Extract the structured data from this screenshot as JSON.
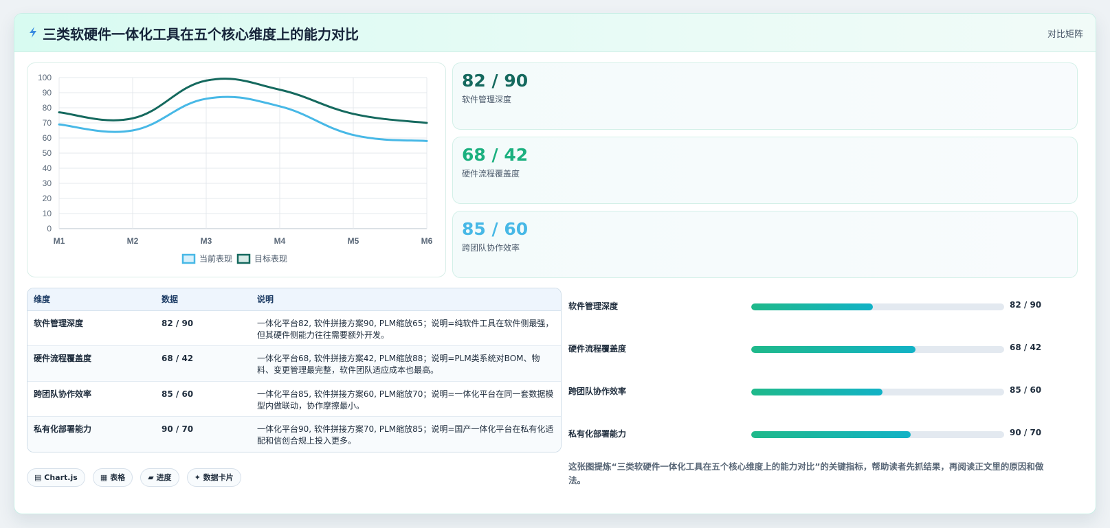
{
  "header": {
    "icon": "lightning-icon",
    "title": "三类软硬件一体化工具在五个核心维度上的能力对比",
    "tag": "对比矩阵"
  },
  "colors": {
    "current": "#47b8e6",
    "target": "#15695e",
    "kpi1": "#15695e",
    "kpi2": "#1bb07f",
    "kpi3": "#47b8e6"
  },
  "chart_data": {
    "type": "line",
    "x": [
      "M1",
      "M2",
      "M3",
      "M4",
      "M5",
      "M6"
    ],
    "ylim": [
      0,
      100
    ],
    "yticks": [
      "0",
      "10",
      "20",
      "30",
      "40",
      "50",
      "60",
      "70",
      "80",
      "90",
      "100"
    ],
    "grid": true,
    "legend_position": "bottom",
    "series": [
      {
        "name": "当前表现",
        "values": [
          69,
          65,
          86,
          81,
          62,
          58
        ]
      },
      {
        "name": "目标表现",
        "values": [
          77,
          73,
          98,
          92,
          76,
          70
        ]
      }
    ]
  },
  "kpis": [
    {
      "value": "82 / 90",
      "label": "软件管理深度"
    },
    {
      "value": "68 / 42",
      "label": "硬件流程覆盖度"
    },
    {
      "value": "85 / 60",
      "label": "跨团队协作效率"
    }
  ],
  "table": {
    "headers": [
      "维度",
      "数据",
      "说明"
    ],
    "rows": [
      {
        "dim": "软件管理深度",
        "num": "82 / 90",
        "desc": "一体化平台82, 软件拼接方案90, PLM缩放65；说明=纯软件工具在软件侧最强，但其硬件侧能力往往需要额外开发。"
      },
      {
        "dim": "硬件流程覆盖度",
        "num": "68 / 42",
        "desc": "一体化平台68, 软件拼接方案42, PLM缩放88；说明=PLM类系统对BOM、物料、变更管理最完整，软件团队适应成本也最高。"
      },
      {
        "dim": "跨团队协作效率",
        "num": "85 / 60",
        "desc": "一体化平台85, 软件拼接方案60, PLM缩放70；说明=一体化平台在同一套数据模型内做联动，协作摩擦最小。"
      },
      {
        "dim": "私有化部署能力",
        "num": "90 / 70",
        "desc": "一体化平台90, 软件拼接方案70, PLM缩放85；说明=国产一体化平台在私有化适配和信创合规上投入更多。"
      }
    ]
  },
  "bars": [
    {
      "label": "软件管理深度",
      "value": "82 / 90",
      "fraction": 0.48
    },
    {
      "label": "硬件流程覆盖度",
      "value": "68 / 42",
      "fraction": 0.65
    },
    {
      "label": "跨团队协作效率",
      "value": "85 / 60",
      "fraction": 0.52
    },
    {
      "label": "私有化部署能力",
      "value": "90 / 70",
      "fraction": 0.63
    }
  ],
  "summary": "这张图提炼“三类软硬件一体化工具在五个核心维度上的能力对比”的关键指标，帮助读者先抓结果，再阅读正文里的原因和做法。",
  "chips": [
    {
      "icon": "chart-icon",
      "label": "Chart.js"
    },
    {
      "icon": "table-icon",
      "label": "表格"
    },
    {
      "icon": "progress-icon",
      "label": "进度"
    },
    {
      "icon": "sparkle-icon",
      "label": "数据卡片"
    }
  ]
}
